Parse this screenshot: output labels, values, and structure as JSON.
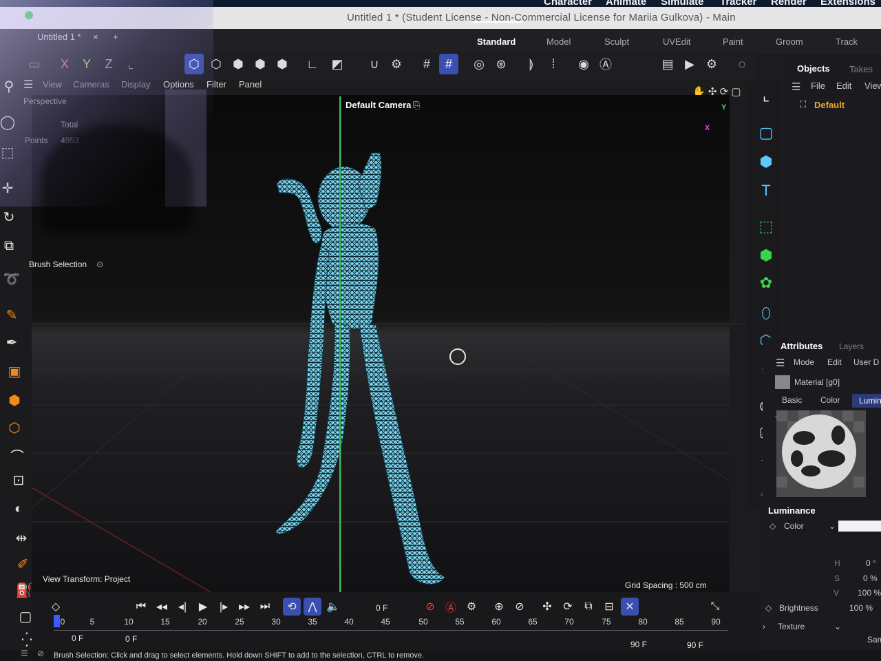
{
  "menubar": {
    "items": [
      "Character",
      "Animate",
      "Simulate",
      "Tracker",
      "Render",
      "Extensions"
    ]
  },
  "window": {
    "title": "Untitled 1 * (Student License - Non-Commercial License for Mariia Gulkova) - Main"
  },
  "document_tab": {
    "label": "Untitled 1 *",
    "close": "×",
    "add": "+"
  },
  "layout_tabs": [
    "Standard",
    "Model",
    "Sculpt",
    "UVEdit",
    "Paint",
    "Groom",
    "Track"
  ],
  "toolbar": {
    "axis_x": "X",
    "axis_y": "Y",
    "axis_z": "Z"
  },
  "viewport_menu": [
    "View",
    "Cameras",
    "Display",
    "Options",
    "Filter",
    "Panel"
  ],
  "viewport": {
    "projection": "Perspective",
    "camera": "Default Camera",
    "stats_total": "Total",
    "stats_points_label": "Points",
    "stats_points_value": "4953",
    "tool_label": "Brush Selection",
    "view_transform": "View Transform: Project",
    "grid_spacing": "Grid Spacing : 500 cm",
    "axis_y": "Y",
    "axis_x": "X"
  },
  "objects_panel": {
    "tabs": [
      "Objects",
      "Takes"
    ],
    "menu": [
      "File",
      "Edit",
      "View"
    ],
    "items": [
      "Default"
    ]
  },
  "attributes_panel": {
    "tabs": [
      "Attributes",
      "Layers"
    ],
    "menu": [
      "Mode",
      "Edit",
      "User D"
    ],
    "material_name": "Material [g0]",
    "subtabs": [
      "Basic",
      "Color",
      "Lumin"
    ],
    "section": "Luminance",
    "color_label": "Color",
    "h_label": "H",
    "h_value": "0 °",
    "s_label": "S",
    "s_value": "0 %",
    "v_label": "V",
    "v_value": "100 %",
    "brightness_label": "Brightness",
    "brightness_value": "100 %",
    "texture_label": "Texture",
    "sample_label": "Sam"
  },
  "timeline": {
    "current_frame": "0 F",
    "ticks": [
      "0",
      "5",
      "10",
      "15",
      "20",
      "25",
      "30",
      "35",
      "40",
      "45",
      "50",
      "55",
      "60",
      "65",
      "70",
      "75",
      "80",
      "85",
      "90"
    ],
    "start_a": "0 F",
    "start_b": "0 F",
    "end_a": "90 F",
    "end_b": "90 F"
  },
  "status": {
    "text": "Brush Selection: Click and drag to select elements. Hold down SHIFT to add to the selection, CTRL to remove."
  },
  "colors": {
    "accent_blue": "#3a4fb0",
    "axis_green": "#2ec45a",
    "mesh_cyan": "#6fd3ff",
    "object_orange": "#f5a524"
  }
}
